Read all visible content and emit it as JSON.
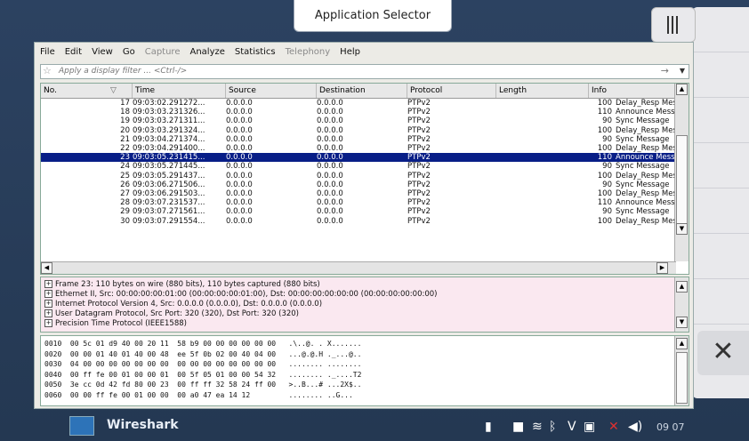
{
  "app_selector": {
    "title": "Application Selector"
  },
  "menubar": {
    "items": [
      {
        "label": "File",
        "enabled": true
      },
      {
        "label": "Edit",
        "enabled": true
      },
      {
        "label": "View",
        "enabled": true
      },
      {
        "label": "Go",
        "enabled": true
      },
      {
        "label": "Capture",
        "enabled": false
      },
      {
        "label": "Analyze",
        "enabled": true
      },
      {
        "label": "Statistics",
        "enabled": true
      },
      {
        "label": "Telephony",
        "enabled": false
      },
      {
        "label": "Help",
        "enabled": true
      }
    ]
  },
  "filter": {
    "placeholder": "Apply a display filter ... <Ctrl-/>",
    "star_icon": "bookmark-star-icon",
    "apply_icon": "arrow-right-icon"
  },
  "packet_list": {
    "columns": [
      "No.",
      "Time",
      "Source",
      "Destination",
      "Protocol",
      "Length",
      "Info"
    ],
    "selected_no": "23",
    "rows": [
      {
        "no": "17",
        "time": "09:03:02.291272...",
        "src": "0.0.0.0",
        "dst": "0.0.0.0",
        "proto": "PTPv2",
        "len": "100",
        "info": "Delay_Resp Message"
      },
      {
        "no": "18",
        "time": "09:03:03.231326...",
        "src": "0.0.0.0",
        "dst": "0.0.0.0",
        "proto": "PTPv2",
        "len": "110",
        "info": "Announce Message"
      },
      {
        "no": "19",
        "time": "09:03:03.271311...",
        "src": "0.0.0.0",
        "dst": "0.0.0.0",
        "proto": "PTPv2",
        "len": "90",
        "info": "Sync Message"
      },
      {
        "no": "20",
        "time": "09:03:03.291324...",
        "src": "0.0.0.0",
        "dst": "0.0.0.0",
        "proto": "PTPv2",
        "len": "100",
        "info": "Delay_Resp Message"
      },
      {
        "no": "21",
        "time": "09:03:04.271374...",
        "src": "0.0.0.0",
        "dst": "0.0.0.0",
        "proto": "PTPv2",
        "len": "90",
        "info": "Sync Message"
      },
      {
        "no": "22",
        "time": "09:03:04.291400...",
        "src": "0.0.0.0",
        "dst": "0.0.0.0",
        "proto": "PTPv2",
        "len": "100",
        "info": "Delay_Resp Message"
      },
      {
        "no": "23",
        "time": "09:03:05.231415...",
        "src": "0.0.0.0",
        "dst": "0.0.0.0",
        "proto": "PTPv2",
        "len": "110",
        "info": "Announce Message"
      },
      {
        "no": "24",
        "time": "09:03:05.271445...",
        "src": "0.0.0.0",
        "dst": "0.0.0.0",
        "proto": "PTPv2",
        "len": "90",
        "info": "Sync Message"
      },
      {
        "no": "25",
        "time": "09:03:05.291437...",
        "src": "0.0.0.0",
        "dst": "0.0.0.0",
        "proto": "PTPv2",
        "len": "100",
        "info": "Delay_Resp Message"
      },
      {
        "no": "26",
        "time": "09:03:06.271506...",
        "src": "0.0.0.0",
        "dst": "0.0.0.0",
        "proto": "PTPv2",
        "len": "90",
        "info": "Sync Message"
      },
      {
        "no": "27",
        "time": "09:03:06.291503...",
        "src": "0.0.0.0",
        "dst": "0.0.0.0",
        "proto": "PTPv2",
        "len": "100",
        "info": "Delay_Resp Message"
      },
      {
        "no": "28",
        "time": "09:03:07.231537...",
        "src": "0.0.0.0",
        "dst": "0.0.0.0",
        "proto": "PTPv2",
        "len": "110",
        "info": "Announce Message"
      },
      {
        "no": "29",
        "time": "09:03:07.271561...",
        "src": "0.0.0.0",
        "dst": "0.0.0.0",
        "proto": "PTPv2",
        "len": "90",
        "info": "Sync Message"
      },
      {
        "no": "30",
        "time": "09:03:07.291554...",
        "src": "0.0.0.0",
        "dst": "0.0.0.0",
        "proto": "PTPv2",
        "len": "100",
        "info": "Delay_Resp Message"
      }
    ]
  },
  "details": {
    "rows": [
      "Frame 23: 110 bytes on wire (880 bits), 110 bytes captured (880 bits)",
      "Ethernet II, Src: 00:00:00:00:01:00 (00:00:00:00:01:00), Dst: 00:00:00:00:00:00 (00:00:00:00:00:00)",
      "Internet Protocol Version 4, Src: 0.0.0.0 (0.0.0.0), Dst: 0.0.0.0 (0.0.0.0)",
      "User Datagram Protocol, Src Port: 320 (320), Dst Port: 320 (320)",
      "Precision Time Protocol (IEEE1588)"
    ]
  },
  "hex": {
    "rows": [
      "0010  00 5c 01 d9 40 00 20 11  58 b9 00 00 00 00 00 00   .\\..@. . X.......",
      "0020  00 00 01 40 01 40 00 48  ee 5f 0b 02 00 40 04 00   ...@.@.H ._...@..",
      "0030  04 00 00 00 00 00 00 00  00 00 00 00 00 00 00 00   ........ ........",
      "0040  00 ff fe 00 01 00 00 01  00 5f 05 01 00 00 54 32   ........ ._....T2",
      "0050  3e cc 0d 42 fd 80 00 23  00 ff ff 32 58 24 ff 00   >..B...# ...2X$..",
      "0060  00 00 ff fe 00 01 00 00  00 a0 47 ea 14 12         ........ ..G..."
    ]
  },
  "taskbar": {
    "app_label": "Wireshark",
    "clock": "09 07"
  },
  "colors": {
    "selection": "#081e87",
    "details_bg": "#fae8f0",
    "desktop": "#2c4261"
  }
}
